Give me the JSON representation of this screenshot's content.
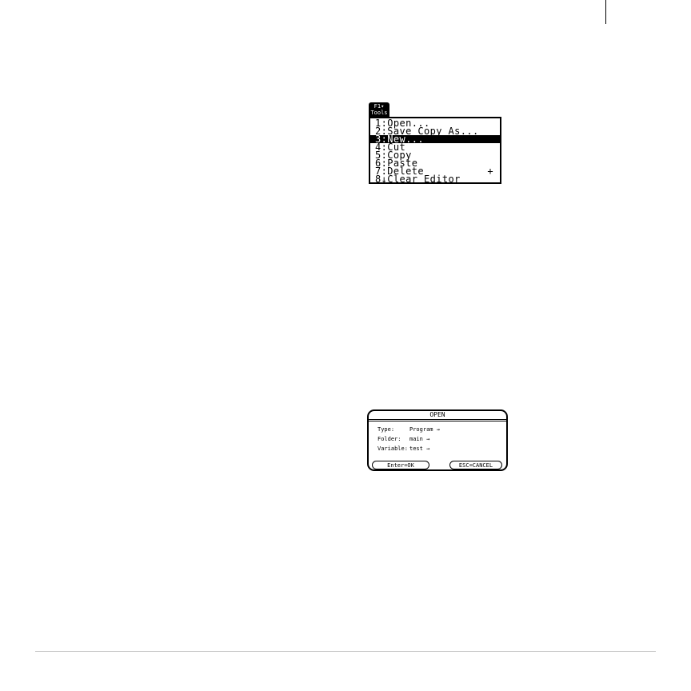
{
  "tools_menu": {
    "tab_label_top": "F1▾",
    "tab_label_bottom": "Tools",
    "items": [
      {
        "label": "1:Open..."
      },
      {
        "label": "2:Save Copy As..."
      },
      {
        "label": "3:New..."
      },
      {
        "label": "4:Cut"
      },
      {
        "label": "5:Copy"
      },
      {
        "label": "6:Paste"
      },
      {
        "label": "7:Delete"
      },
      {
        "label": "8↓Clear Editor"
      }
    ],
    "selected_index": 2,
    "delete_marker": "+"
  },
  "open_dialog": {
    "title": "OPEN",
    "fields": [
      {
        "label": "Type:",
        "value": "Program →"
      },
      {
        "label": "Folder:",
        "value": "main →"
      },
      {
        "label": "Variable:",
        "value": "test →"
      }
    ],
    "ok_label": "Enter=OK",
    "cancel_label": "ESC=CANCEL"
  }
}
